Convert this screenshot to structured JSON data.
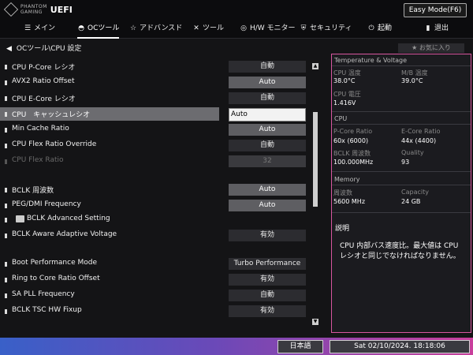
{
  "header": {
    "brand_line1": "PHANTOM",
    "brand_line2": "GAMING",
    "brand_uefi": "UEFI",
    "easy_mode": "Easy Mode(F6)"
  },
  "nav": {
    "main": "メイン",
    "oc": "OCツール",
    "advanced": "アドバンスド",
    "tool": "ツール",
    "hw": "H/W モニター",
    "security": "セキュリティ",
    "boot": "起動",
    "exit": "退出"
  },
  "breadcrumb": "OCツール\\CPU 設定",
  "favorite": "お気に入り",
  "settings": [
    {
      "label": "CPU P-Core レシオ",
      "value": "自動"
    },
    {
      "label": "AVX2 Ratio Offset",
      "value": "Auto"
    },
    {
      "label": "CPU E-Core レシオ",
      "value": "自動"
    },
    {
      "label": "CPU　キャッシュレシオ",
      "value": "Auto"
    },
    {
      "label": "Min Cache  Ratio",
      "value": "Auto"
    },
    {
      "label": "CPU Flex   Ratio Override",
      "value": "自動"
    },
    {
      "label": "CPU Flex   Ratio",
      "value": "32"
    },
    {
      "label": "BCLK 周波数",
      "value": "Auto"
    },
    {
      "label": "PEG/DMI Frequency",
      "value": "Auto"
    },
    {
      "label": "BCLK Advanced Setting"
    },
    {
      "label": "BCLK Aware Adaptive Voltage",
      "value": "有効"
    },
    {
      "label": "Boot Performance Mode",
      "value": "Turbo Performance"
    },
    {
      "label": "Ring to Core Ratio Offset",
      "value": "有効"
    },
    {
      "label": "SA PLL Frequency",
      "value": "自動"
    },
    {
      "label": "BCLK TSC HW Fixup",
      "value": "有効"
    }
  ],
  "panel": {
    "title": "Temperature & Voltage",
    "cpu_temp_label": "CPU 温度",
    "cpu_temp": "38.0°C",
    "mb_temp_label": "M/B 温度",
    "mb_temp": "39.0°C",
    "cpu_volt_label": "CPU 電圧",
    "cpu_volt": "1.416V",
    "cpu_title": "CPU",
    "pcore_label": "P-Core Ratio",
    "pcore": "60x (6000)",
    "ecore_label": "E-Core Ratio",
    "ecore": "44x (4400)",
    "bclk_label": "BCLK 周波数",
    "bclk": "100.000MHz",
    "quality_label": "Quality",
    "quality": "93",
    "mem_title": "Memory",
    "freq_label": "周波数",
    "freq": "5600 MHz",
    "cap_label": "Capacity",
    "cap": "24 GB",
    "desc_title": "説明",
    "desc": "CPU 内部バス速度比。最大値は CPU レシオと同じでなければなりません。"
  },
  "footer": {
    "language": "日本語",
    "datetime": "Sat 02/10/2024. 18:18:06"
  }
}
